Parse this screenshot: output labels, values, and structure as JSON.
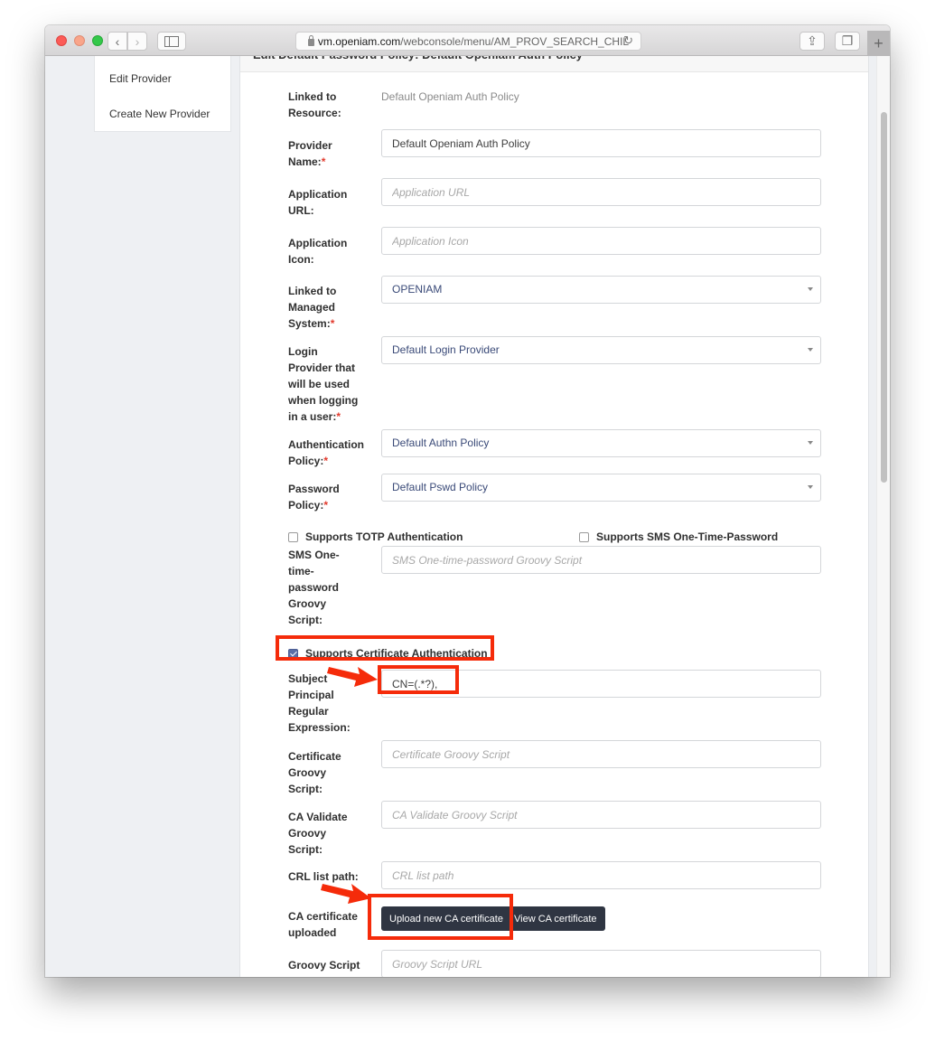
{
  "browser": {
    "url_domain": "vm.openiam.com",
    "url_path": "/webconsole/menu/AM_PROV_SEARCH_CHIL",
    "reload_icon": "↻",
    "back_icon": "‹",
    "forward_icon": "›",
    "share_icon": "⇪",
    "tabs_icon": "❐",
    "new_tab_icon": "+"
  },
  "left_menu": {
    "items": [
      {
        "label": "Edit Provider"
      },
      {
        "label": "Create New Provider"
      }
    ]
  },
  "panel": {
    "header": "Edit Default Password Policy: Default Openiam Auth Policy"
  },
  "form": {
    "linked_resource": {
      "label": "Linked to Resource:",
      "value": "Default Openiam Auth Policy"
    },
    "provider_name": {
      "label": "Provider Name:",
      "required": "*",
      "value": "Default Openiam Auth Policy"
    },
    "application_url": {
      "label": "Application URL:",
      "placeholder": "Application URL"
    },
    "application_icon": {
      "label": "Application Icon:",
      "placeholder": "Application Icon"
    },
    "managed_system": {
      "label": "Linked to Managed System:",
      "required": "*",
      "value": "OPENIAM"
    },
    "login_provider": {
      "label": "Login Provider that will be used when logging in a user:",
      "required": "*",
      "value": "Default Login Provider"
    },
    "auth_policy": {
      "label": "Authentication Policy:",
      "required": "*",
      "value": "Default Authn Policy"
    },
    "password_policy": {
      "label": "Password Policy:",
      "required": "*",
      "value": "Default Pswd Policy"
    },
    "totp": {
      "label": "Supports TOTP Authentication",
      "checked": false
    },
    "sms_otp": {
      "label": "Supports SMS One-Time-Password",
      "checked": false
    },
    "sms_script": {
      "label": "SMS One-time-password Groovy Script:",
      "placeholder": "SMS One-time-password Groovy Script"
    },
    "cert_auth": {
      "label": "Supports Certificate Authentication",
      "checked": true
    },
    "subject_regex": {
      "label": "Subject Principal Regular Expression:",
      "value": "CN=(.*?),"
    },
    "cert_script": {
      "label": "Certificate Groovy Script:",
      "placeholder": "Certificate Groovy Script"
    },
    "ca_validate": {
      "label": "CA Validate Groovy Script:",
      "placeholder": "CA Validate Groovy Script"
    },
    "crl_path": {
      "label": "CRL list path:",
      "placeholder": "CRL list path"
    },
    "ca_cert": {
      "label": "CA certificate uploaded",
      "upload_label": "Upload new CA certificate",
      "view_label": "View CA certificate"
    },
    "groovy_url": {
      "label": "Groovy Script URL:",
      "placeholder": "Groovy Script URL"
    }
  },
  "colors": {
    "annotation": "#f52b0a",
    "dark_button": "#2f3542",
    "required": "#e23b2e"
  }
}
